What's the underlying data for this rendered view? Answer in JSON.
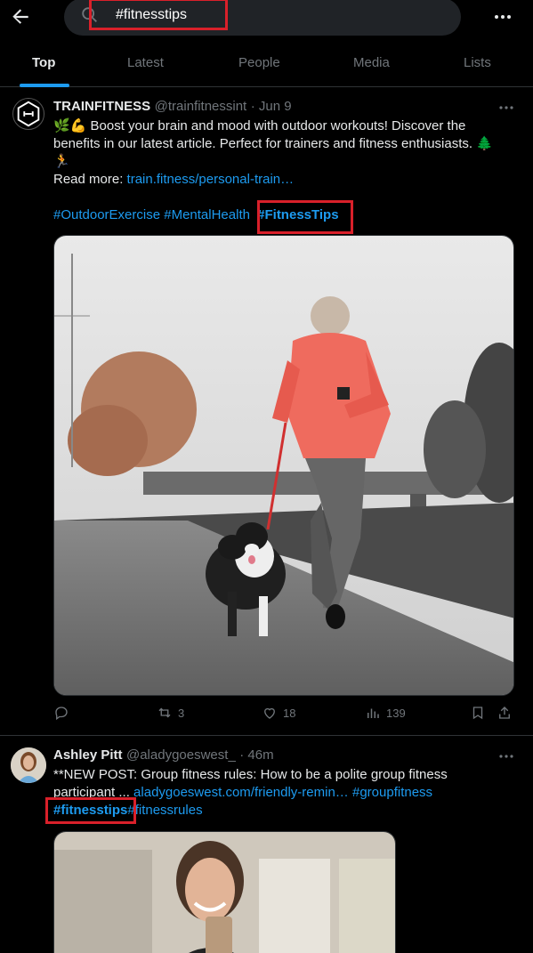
{
  "search": {
    "query": "#fitnesstips"
  },
  "tabs": [
    {
      "label": "Top"
    },
    {
      "label": "Latest"
    },
    {
      "label": "People"
    },
    {
      "label": "Media"
    },
    {
      "label": "Lists"
    }
  ],
  "posts": [
    {
      "author": "TRAINFITNESS",
      "handle": "@trainfitnessint",
      "time": "· Jun 9",
      "line1": "🌿💪 Boost your brain and mood with outdoor workouts! Discover the",
      "line2": "benefits in our latest article. Perfect for trainers and fitness enthusiasts. 🌲",
      "line3": "🏃",
      "read_more_label": "Read more:",
      "link": "train.fitness/personal-train…",
      "hashtags": [
        "#OutdoorExercise",
        "#MentalHealth",
        "#FitnessTips"
      ],
      "stats": {
        "replies": "",
        "reposts": "3",
        "likes": "18",
        "views": "139"
      }
    },
    {
      "author": "Ashley Pitt",
      "handle": "@aladygoeswest_",
      "time": "· 46m",
      "line1": "**NEW POST: Group fitness rules: How to be a polite group fitness",
      "line2_text": "participant ... ",
      "link": "aladygoeswest.com/friendly-remin…",
      "hashtag_inline": "#groupfitness",
      "hashtags_line3": [
        "#fitnesstips",
        "#fitnessrules"
      ]
    }
  ],
  "colors": {
    "accent": "#1d9bf0",
    "highlight": "#d9202a",
    "background": "#000000"
  }
}
